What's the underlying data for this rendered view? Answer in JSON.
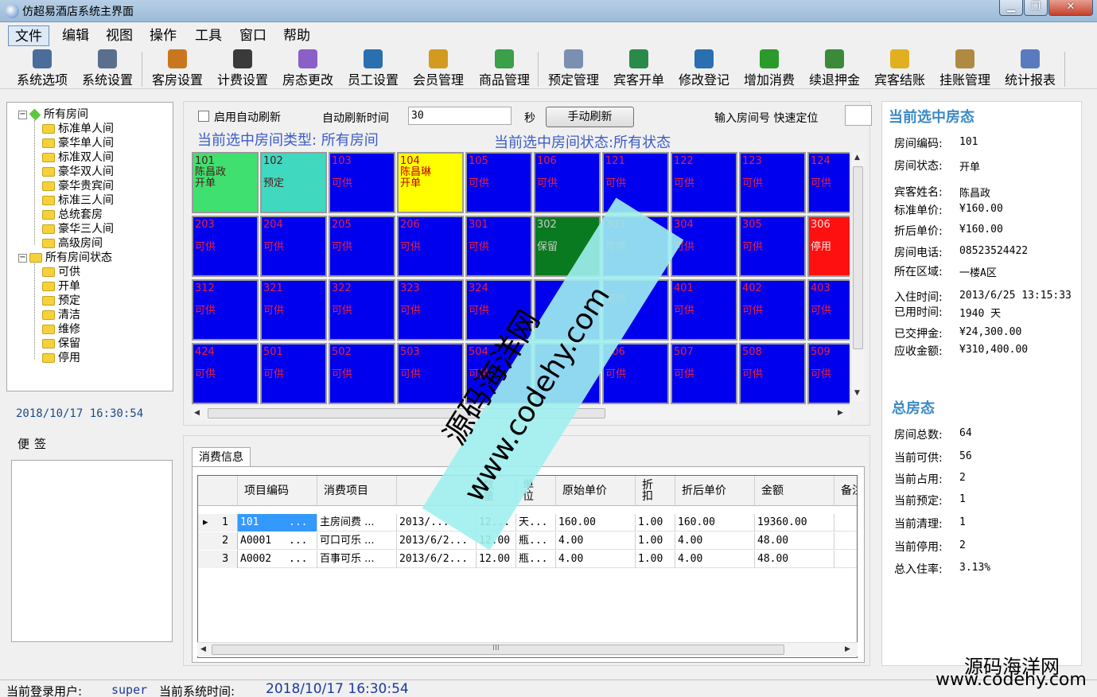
{
  "window": {
    "title": "仿超易酒店系统主界面",
    "min": "▁",
    "max": "❐",
    "close": "✕"
  },
  "menu": [
    "文件",
    "编辑",
    "视图",
    "操作",
    "工具",
    "窗口",
    "帮助"
  ],
  "toolbar": [
    {
      "label": "系统选项",
      "icon": "wrench-icon",
      "color": "#4a6d9a"
    },
    {
      "label": "系统设置",
      "icon": "gear-icon",
      "color": "#5a6f8c"
    },
    {
      "label": "客房设置",
      "icon": "house-icon",
      "color": "#c9771f"
    },
    {
      "label": "计费设置",
      "icon": "cash-register-icon",
      "color": "#3a3a3a"
    },
    {
      "label": "房态更改",
      "icon": "building-icon",
      "color": "#8a5fc7"
    },
    {
      "label": "员工设置",
      "icon": "person-icon",
      "color": "#2a6fb0"
    },
    {
      "label": "会员管理",
      "icon": "vip-icon",
      "color": "#d39a20"
    },
    {
      "label": "商品管理",
      "icon": "shopping-bag-icon",
      "color": "#3aa04a"
    },
    {
      "label": "预定管理",
      "icon": "booking-icon",
      "color": "#7b8fb0"
    },
    {
      "label": "宾客开单",
      "icon": "add-guest-icon",
      "color": "#2a8a4a"
    },
    {
      "label": "修改登记",
      "icon": "edit-guest-icon",
      "color": "#2a6fb0"
    },
    {
      "label": "增加消费",
      "icon": "plus-icon",
      "color": "#2a9a2a"
    },
    {
      "label": "续退押金",
      "icon": "deposit-icon",
      "color": "#3a8a3a"
    },
    {
      "label": "宾客结账",
      "icon": "yen-icon",
      "color": "#e0b020"
    },
    {
      "label": "挂账管理",
      "icon": "money-bag-icon",
      "color": "#b08a40"
    },
    {
      "label": "统计报表",
      "icon": "chart-icon",
      "color": "#5a7ac0"
    }
  ],
  "tree": {
    "root1": "所有房间",
    "room_types": [
      "标准单人间",
      "豪华单人间",
      "标准双人间",
      "豪华双人间",
      "豪华贵宾间",
      "标准三人间",
      "总统套房",
      "豪华三人间",
      "高级房间"
    ],
    "root2": "所有房间状态",
    "states": [
      "可供",
      "开单",
      "预定",
      "清洁",
      "维修",
      "保留",
      "停用"
    ]
  },
  "left": {
    "datetime": "2018/10/17 16:30:54",
    "note_label": "便签"
  },
  "refresh": {
    "auto_label": "启用自动刷新",
    "interval_label": "自动刷新时间",
    "interval_value": "30",
    "sec": "秒",
    "manual_btn": "手动刷新",
    "room_input_label": "输入房间号 快速定位"
  },
  "selection": {
    "type_text": "当前选中房间类型:  所有房间",
    "status_text": "当前选中房间状态:所有状态"
  },
  "colors": {
    "available": "#0000ee",
    "open": "#ffff00",
    "reserved": "#40d9c0",
    "hold": "#0a7a20",
    "disabled": "#ff1010",
    "checkin": "#40e070"
  },
  "rooms": [
    [
      {
        "no": "101",
        "guest": "陈昌政",
        "state": "开单",
        "c": "checkin"
      },
      {
        "no": "102",
        "state": "预定",
        "c": "reserved"
      },
      {
        "no": "103",
        "state": "可供",
        "c": "available"
      },
      {
        "no": "104",
        "guest": "陈昌琳",
        "state": "开单",
        "c": "open"
      },
      {
        "no": "105",
        "state": "可供",
        "c": "available"
      },
      {
        "no": "106",
        "state": "可供",
        "c": "available"
      },
      {
        "no": "121",
        "state": "可供",
        "c": "available"
      },
      {
        "no": "122",
        "state": "可供",
        "c": "available"
      },
      {
        "no": "123",
        "state": "可供",
        "c": "available"
      },
      {
        "no": "124",
        "state": "可供",
        "c": "available"
      }
    ],
    [
      {
        "no": "203",
        "state": "可供",
        "c": "available"
      },
      {
        "no": "204",
        "state": "可供",
        "c": "available"
      },
      {
        "no": "205",
        "state": "可供",
        "c": "available"
      },
      {
        "no": "206",
        "state": "可供",
        "c": "available"
      },
      {
        "no": "301",
        "state": "可供",
        "c": "available"
      },
      {
        "no": "302",
        "state": "保留",
        "c": "hold"
      },
      {
        "no": "303",
        "state": "可供",
        "c": "available"
      },
      {
        "no": "304",
        "state": "可供",
        "c": "available"
      },
      {
        "no": "305",
        "state": "可供",
        "c": "available"
      },
      {
        "no": "306",
        "state": "停用",
        "c": "disabled"
      }
    ],
    [
      {
        "no": "312",
        "state": "可供",
        "c": "available"
      },
      {
        "no": "321",
        "state": "可供",
        "c": "available"
      },
      {
        "no": "322",
        "state": "可供",
        "c": "available"
      },
      {
        "no": "323",
        "state": "可供",
        "c": "available"
      },
      {
        "no": "324",
        "state": "可供",
        "c": "available"
      },
      {
        "no": "",
        "state": "",
        "c": "available"
      },
      {
        "no": "",
        "state": "可供",
        "c": "available"
      },
      {
        "no": "401",
        "state": "可供",
        "c": "available"
      },
      {
        "no": "402",
        "state": "可供",
        "c": "available"
      },
      {
        "no": "403",
        "state": "可供",
        "c": "available"
      }
    ],
    [
      {
        "no": "424",
        "state": "可供",
        "c": "available"
      },
      {
        "no": "501",
        "state": "可供",
        "c": "available"
      },
      {
        "no": "502",
        "state": "可供",
        "c": "available"
      },
      {
        "no": "503",
        "state": "可供",
        "c": "available"
      },
      {
        "no": "504",
        "state": "可供",
        "c": "available"
      },
      {
        "no": "",
        "state": "",
        "c": "available"
      },
      {
        "no": "506",
        "state": "可供",
        "c": "available"
      },
      {
        "no": "507",
        "state": "可供",
        "c": "available"
      },
      {
        "no": "508",
        "state": "可供",
        "c": "available"
      },
      {
        "no": "509",
        "state": "可供",
        "c": "available"
      }
    ]
  ],
  "consume": {
    "tab": "消费信息",
    "headers": [
      "项目编码",
      "消费项目",
      "",
      "数\n量",
      "单\n位",
      "原始单价",
      "折\n扣",
      "折后单价",
      "金额",
      "备注"
    ],
    "rows": [
      {
        "idx": "1",
        "code": "101",
        "dots": "...",
        "item": "主房间费 ...",
        "date": "2013/...",
        "qty": "12...",
        "unit": "天...",
        "price": "160.00",
        "disc": "1.00",
        "dprice": "160.00",
        "amount": "19360.00"
      },
      {
        "idx": "2",
        "code": "A0001",
        "dots": "...",
        "item": "可口可乐 ...",
        "date": "2013/6/2...",
        "qty": "12.00",
        "unit": "瓶...",
        "price": "4.00",
        "disc": "1.00",
        "dprice": "4.00",
        "amount": "48.00"
      },
      {
        "idx": "3",
        "code": "A0002",
        "dots": "...",
        "item": "百事可乐 ...",
        "date": "2013/6/2...",
        "qty": "12.00",
        "unit": "瓶...",
        "price": "4.00",
        "disc": "1.00",
        "dprice": "4.00",
        "amount": "48.00"
      }
    ],
    "scroll_mark": "III"
  },
  "current": {
    "heading": "当前选中房态",
    "fields": [
      {
        "k": "房间编码:",
        "v": "101"
      },
      {
        "k": "房间状态:",
        "v": "开单"
      },
      {
        "k": "宾客姓名:",
        "v": "陈昌政"
      },
      {
        "k": "标准单价:",
        "v": "¥160.00"
      },
      {
        "k": "折后单价:",
        "v": "¥160.00"
      },
      {
        "k": "房间电话:",
        "v": "08523524422"
      },
      {
        "k": "所在区域:",
        "v": "一楼A区"
      },
      {
        "k": "入住时间:",
        "v": "2013/6/25 13:15:33"
      },
      {
        "k": "已用时间:",
        "v": "1940 天"
      },
      {
        "k": "已交押金:",
        "v": "¥24,300.00"
      },
      {
        "k": "应收金额:",
        "v": "¥310,400.00"
      }
    ]
  },
  "summary": {
    "heading": "总房态",
    "fields": [
      {
        "k": "房间总数:",
        "v": "64"
      },
      {
        "k": "当前可供:",
        "v": "56"
      },
      {
        "k": "当前占用:",
        "v": "2"
      },
      {
        "k": "当前预定:",
        "v": "1"
      },
      {
        "k": "当前清理:",
        "v": "1"
      },
      {
        "k": "当前停用:",
        "v": "2"
      },
      {
        "k": "总入住率:",
        "v": "3.13%"
      }
    ]
  },
  "status": {
    "user_label": "当前登录用户:",
    "user": "super",
    "time_label": "当前系统时间:",
    "time": "2018/10/17 16:30:54"
  },
  "watermark": {
    "cn": "源码海洋网",
    "url": "www.codehy.com"
  }
}
